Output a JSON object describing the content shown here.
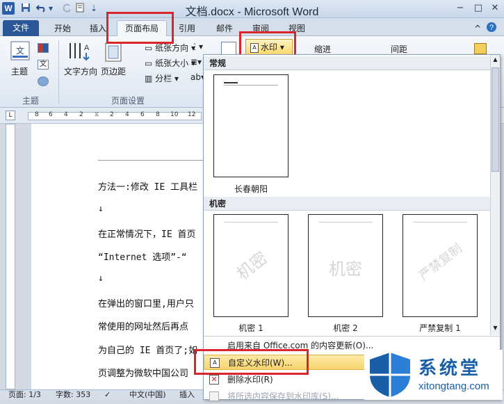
{
  "window": {
    "app_logo": "W",
    "title": "文档.docx - Microsoft Word",
    "quick_access": [
      "save-icon",
      "undo-icon",
      "redo-icon",
      "customize-icon"
    ],
    "controls": [
      "−",
      "□",
      "✕"
    ]
  },
  "tabs": [
    {
      "label": "文件"
    },
    {
      "label": "开始"
    },
    {
      "label": "插入"
    },
    {
      "label": "页面布局",
      "active": true
    },
    {
      "label": "引用"
    },
    {
      "label": "邮件"
    },
    {
      "label": "审阅"
    },
    {
      "label": "视图"
    }
  ],
  "ribbon": {
    "theme_label": "主题",
    "theme_group": "主题",
    "text_direction": "文字方向",
    "margins": "页边距",
    "orientation": "纸张方向",
    "size": "纸张大小",
    "columns": "分栏",
    "page_setup_group": "页面设置",
    "watermark": "水印",
    "indent": "缩进",
    "spacing": "间距"
  },
  "ruler": {
    "ticks": [
      "8",
      "6",
      "4",
      "2",
      "",
      "2",
      "4",
      "6",
      "8",
      "10",
      "12"
    ]
  },
  "document": {
    "lines": [
      "方法一:修改 IE 工具栏",
      "↓",
      "在正常情况下，IE 首页",
      "“Internet 选项”-“",
      "↓",
      "在弹出的窗口里,用户只",
      "常使用的网址然后再点",
      "为自己的 IE 首页了;如",
      "页调整为微软中国公司"
    ]
  },
  "watermark_menu": {
    "section_general": "常规",
    "section_confidential": "机密",
    "general_items": [
      {
        "caption": "长春朝阳",
        "watermark": ""
      }
    ],
    "confidential_items": [
      {
        "caption": "机密 1",
        "watermark": "机密"
      },
      {
        "caption": "机密 2",
        "watermark": "机密"
      },
      {
        "caption": "严禁复制 1",
        "watermark": "严禁复制"
      }
    ],
    "menu_items": [
      {
        "label": "启用来自 Office.com 的内容更新(O)...",
        "state": "normal"
      },
      {
        "label": "自定义水印(W)...",
        "state": "highlighted"
      },
      {
        "label": "删除水印(R)",
        "state": "normal"
      },
      {
        "label": "将所选内容保存到水印库(S)...",
        "state": "disabled"
      }
    ]
  },
  "statusbar": {
    "page": "页面: 1/3",
    "words": "字数: 353",
    "language": "中文(中国)",
    "mode": "插入"
  },
  "brand": {
    "name": "系统堂",
    "url": "xitongtang.com",
    "color": "#1a5ea8"
  }
}
